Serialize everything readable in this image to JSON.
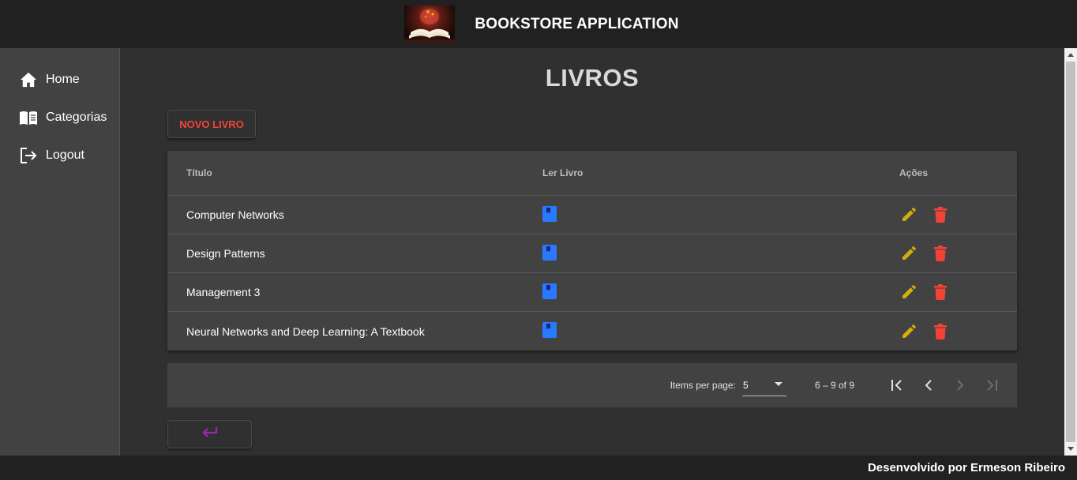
{
  "header": {
    "title": "BOOKSTORE APPLICATION",
    "logo_icon": "open-book-logo"
  },
  "sidebar": {
    "items": [
      {
        "label": "Home",
        "icon": "home-icon"
      },
      {
        "label": "Categorias",
        "icon": "menu-book-icon"
      },
      {
        "label": "Logout",
        "icon": "logout-icon"
      }
    ]
  },
  "main": {
    "title": "LIVROS",
    "new_button_label": "NOVO LIVRO",
    "table": {
      "columns": [
        "Título",
        "Ler Livro",
        "Ações"
      ],
      "rows": [
        {
          "title": "Computer Networks"
        },
        {
          "title": "Design Patterns"
        },
        {
          "title": "Management 3"
        },
        {
          "title": "Neural Networks and Deep Learning: A Textbook"
        }
      ]
    },
    "paginator": {
      "items_per_page_label": "Items per page:",
      "items_per_page_value": "5",
      "range_label": "6 – 9 of 9"
    }
  },
  "footer": {
    "text": "Desenvolvido por Ermeson Ribeiro"
  },
  "colors": {
    "topbar": "#212121",
    "sidebar": "#424242",
    "background": "#303030",
    "accent_red": "#f44336",
    "edit_yellow": "#d4ac0d",
    "book_blue": "#2979ff",
    "back_purple": "#9c27b0"
  }
}
